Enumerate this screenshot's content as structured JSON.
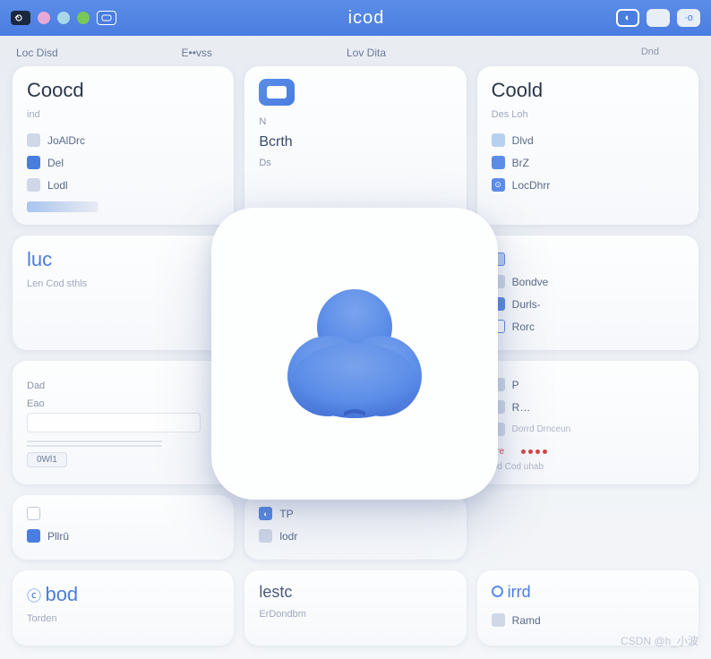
{
  "topbar": {
    "title": "icod",
    "dots": [
      {
        "color": "#e8a8d8"
      },
      {
        "color": "#a8d8e8"
      },
      {
        "color": "#7ac858"
      }
    ],
    "right_btn_1": "◐",
    "right_btn_2": "",
    "right_btn_3": "·o"
  },
  "headers": {
    "col1": "Loc Disd",
    "col2": "E••vss",
    "col3": "Lov Dita",
    "col4": "Dnd"
  },
  "card1": {
    "title": "Coocd",
    "sub": "ind",
    "items": [
      {
        "icon_color": "#d0d8e8",
        "label": "JoAlDrc"
      },
      {
        "icon_color": "#4a7de0",
        "label": "Del"
      },
      {
        "icon_color": "#d0d8e8",
        "label": "Lodl"
      }
    ]
  },
  "card2": {
    "line1": "N",
    "line2": "Bcrth",
    "line3": "Ds"
  },
  "card3": {
    "title": "Coold",
    "sub": "Des Loh",
    "items": [
      {
        "icon_color": "#b8d0f0",
        "label": "Dlvd"
      },
      {
        "icon_color": "#5b8de8",
        "label": "BrZ"
      },
      {
        "icon_color": "#5b8de8",
        "label": "LocDhrr"
      }
    ]
  },
  "card4": {
    "title": "luc",
    "sub": "Len Cod sthls"
  },
  "card5": {
    "items": [
      {
        "icon_color": "#b8d0f0",
        "label": ""
      },
      {
        "icon_color": "#d0d8e8",
        "label": "Bondve"
      },
      {
        "icon_color": "#5b8de8",
        "label": "Durls-"
      },
      {
        "icon_color": "#d0d8e8",
        "label": "Rorc"
      }
    ]
  },
  "card6": {
    "lab1": "Dad",
    "lab2": "Eao",
    "pill": "0Wl1"
  },
  "card7": {
    "items": [
      {
        "icon_color": "#d0d8e8",
        "label": "P"
      },
      {
        "icon_color": "#d0d8e8",
        "label": "R…"
      },
      {
        "icon_color": "#d0d8e8",
        "label": "Dorrd Drnceun"
      }
    ],
    "red_label": "ore",
    "foot": "Sd Cod uhab"
  },
  "card8": {
    "items": [
      {
        "icon_color": "#d0d8e8",
        "label": ""
      },
      {
        "icon_color": "#4a7de0",
        "label": "Pllrū"
      }
    ]
  },
  "card9": {
    "items": [
      {
        "icon_color": "#5b8de8",
        "label": "TP"
      },
      {
        "icon_color": "#d0d8e8",
        "label": "lodr"
      }
    ]
  },
  "card10": {
    "title": "bod",
    "sub": "Torden"
  },
  "card11": {
    "title": "lestc",
    "sub": "ErDondbm"
  },
  "card12": {
    "title": "irrd",
    "sub": "Ramd"
  },
  "watermark": "CSDN @h_小波"
}
